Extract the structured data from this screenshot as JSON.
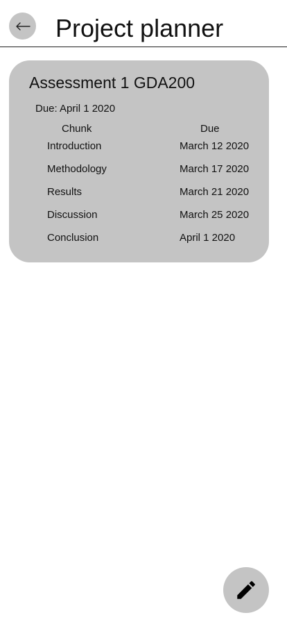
{
  "header": {
    "title": "Project planner",
    "back_icon": "arrow-left-icon"
  },
  "assessment": {
    "title": "Assessment 1 GDA200",
    "due": "Due: April 1 2020",
    "columns": {
      "chunk": "Chunk",
      "due": "Due"
    },
    "rows": [
      {
        "chunk": "Introduction",
        "due": "March 12 2020"
      },
      {
        "chunk": "Methodology",
        "due": "March 17 2020"
      },
      {
        "chunk": "Results",
        "due": "March 21 2020"
      },
      {
        "chunk": "Discussion",
        "due": "March 25 2020"
      },
      {
        "chunk": "Conclusion",
        "due": "April 1 2020"
      }
    ]
  },
  "fab": {
    "icon": "pencil-icon"
  },
  "colors": {
    "surface": "#c4c4c4",
    "text": "#111111",
    "background": "#ffffff"
  }
}
